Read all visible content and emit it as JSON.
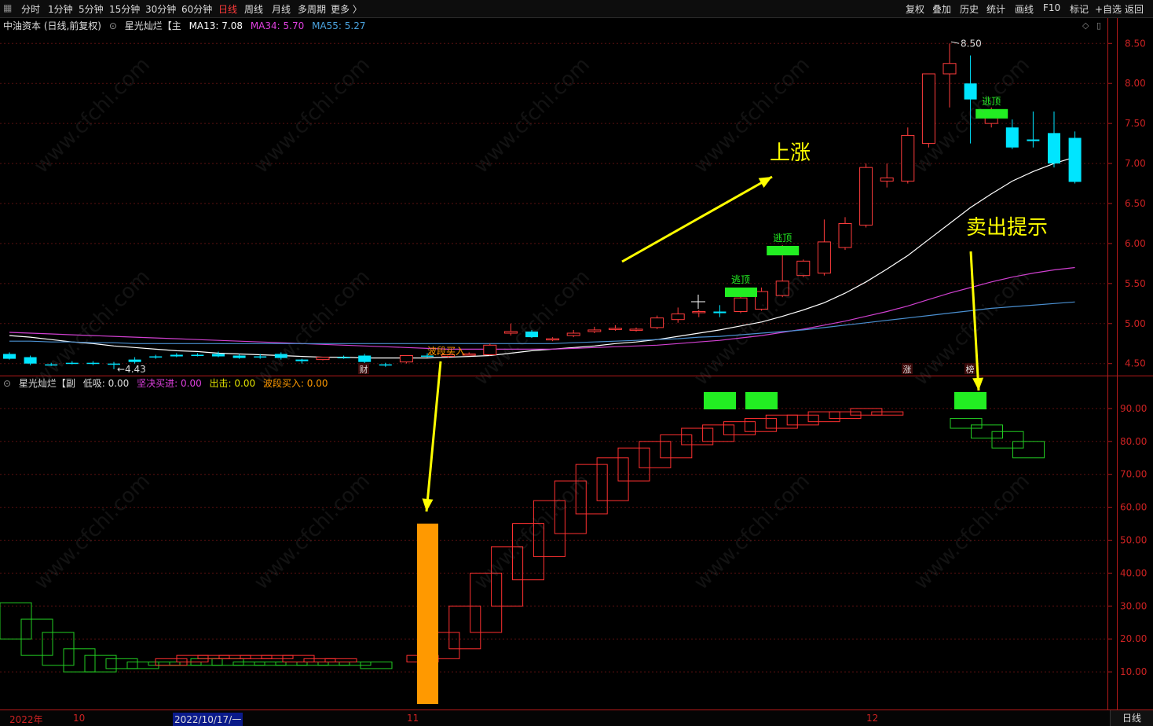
{
  "toolbar": {
    "left_items": [
      "分时",
      "1分钟",
      "5分钟",
      "15分钟",
      "30分钟",
      "60分钟",
      "日线",
      "周线",
      "月线",
      "多周期",
      "更多 〉"
    ],
    "active_index": 6,
    "right_items": [
      "复权",
      "叠加",
      "历史",
      "统计",
      "画线",
      "F10",
      "标记",
      "+自选",
      "返回"
    ]
  },
  "main_info": {
    "stock": "中油资本 (日线,前复权)",
    "indicator": "星光灿烂【主",
    "ma13": "MA13: 7.08",
    "ma34": "MA34: 5.70",
    "ma55": "MA55: 5.27",
    "colors": {
      "ma13": "#ffffff",
      "ma34": "#e040e0",
      "ma55": "#4aa3df"
    }
  },
  "sub_info": {
    "indicator": "星光灿烂【副",
    "dixi": "低吸: 0.00",
    "jianjue": "坚决买进: 0.00",
    "chuji": "出击: 0.00",
    "boduan": "波段买入: 0.00",
    "colors": {
      "dixi": "#dddddd",
      "jianjue": "#e040e0",
      "chuji": "#e0e000",
      "boduan": "#ff9900"
    }
  },
  "annotations": {
    "rise": "上涨",
    "sell_hint": "卖出提示",
    "escape": "逃顶",
    "wave_buy": "波段买入",
    "cai": "财",
    "zhang": "涨",
    "bang": "榜",
    "high_label": "8.50",
    "low_label": "4.43"
  },
  "bottom_bar": {
    "labels": [
      "2022年",
      "10",
      "2022/10/17/一",
      "11",
      "12"
    ],
    "right_button": "日线"
  },
  "watermark": "www.cfchi.com",
  "chart_data": [
    {
      "type": "candlestick",
      "title": "中油资本 (日线,前复权)",
      "ylim": [
        4.35,
        8.65
      ],
      "y_ticks": [
        4.5,
        5.0,
        5.5,
        6.0,
        6.5,
        7.0,
        7.5,
        8.0,
        8.5
      ],
      "candles": [
        [
          4.62,
          4.64,
          4.56,
          4.55
        ],
        [
          4.58,
          4.6,
          4.5,
          4.48
        ],
        [
          4.49,
          4.51,
          4.48,
          4.47
        ],
        [
          4.51,
          4.53,
          4.5,
          4.49
        ],
        [
          4.51,
          4.53,
          4.5,
          4.48
        ],
        [
          4.5,
          4.52,
          4.49,
          4.43
        ],
        [
          4.55,
          4.58,
          4.52,
          4.5
        ],
        [
          4.59,
          4.61,
          4.58,
          4.56
        ],
        [
          4.61,
          4.63,
          4.59,
          4.58
        ],
        [
          4.61,
          4.63,
          4.6,
          4.59
        ],
        [
          4.62,
          4.65,
          4.59,
          4.58
        ],
        [
          4.6,
          4.62,
          4.57,
          4.56
        ],
        [
          4.59,
          4.62,
          4.58,
          4.56
        ],
        [
          4.62,
          4.64,
          4.57,
          4.55
        ],
        [
          4.55,
          4.56,
          4.53,
          4.5
        ],
        [
          4.55,
          4.57,
          4.58,
          4.54
        ],
        [
          4.58,
          4.6,
          4.57,
          4.56
        ],
        [
          4.6,
          4.62,
          4.52,
          4.5
        ],
        [
          4.49,
          4.51,
          4.48,
          4.46
        ],
        [
          4.52,
          4.6,
          4.6,
          4.5
        ],
        [
          4.6,
          4.63,
          4.59,
          4.58
        ],
        [
          4.59,
          4.62,
          4.61,
          4.57
        ],
        [
          4.61,
          4.64,
          4.62,
          4.6
        ],
        [
          4.61,
          4.75,
          4.73,
          4.6
        ],
        [
          4.88,
          5.0,
          4.9,
          4.85
        ],
        [
          4.9,
          4.92,
          4.83,
          4.82
        ],
        [
          4.81,
          4.83,
          4.81,
          4.78
        ],
        [
          4.85,
          4.92,
          4.88,
          4.83
        ],
        [
          4.9,
          4.96,
          4.92,
          4.88
        ],
        [
          4.93,
          4.98,
          4.94,
          4.91
        ],
        [
          4.92,
          4.95,
          4.93,
          4.9
        ],
        [
          4.95,
          5.1,
          5.07,
          4.93
        ],
        [
          5.05,
          5.2,
          5.12,
          5.01
        ],
        [
          5.14,
          5.17,
          5.15,
          5.08
        ],
        [
          5.15,
          5.23,
          5.13,
          5.08
        ],
        [
          5.15,
          5.35,
          5.32,
          5.13
        ],
        [
          5.18,
          5.45,
          5.4,
          5.16
        ],
        [
          5.35,
          5.98,
          5.53,
          5.33
        ],
        [
          5.6,
          5.8,
          5.78,
          5.58
        ],
        [
          5.63,
          6.3,
          6.02,
          5.6
        ],
        [
          5.95,
          6.33,
          6.25,
          5.92
        ],
        [
          6.23,
          7.0,
          6.95,
          6.2
        ],
        [
          6.78,
          7.0,
          6.82,
          6.7
        ],
        [
          6.78,
          7.45,
          7.35,
          6.75
        ],
        [
          7.25,
          7.55,
          8.12,
          7.2
        ],
        [
          8.12,
          8.5,
          8.25,
          7.7
        ],
        [
          8.0,
          8.35,
          7.8,
          7.25
        ],
        [
          7.5,
          7.7,
          7.65,
          7.45
        ],
        [
          7.45,
          7.55,
          7.2,
          7.18
        ],
        [
          7.3,
          7.65,
          7.28,
          7.2
        ],
        [
          7.38,
          7.65,
          7.0,
          6.95
        ],
        [
          7.32,
          7.4,
          6.77,
          6.75
        ]
      ],
      "series": [
        {
          "name": "MA13",
          "values": [
            4.85,
            4.83,
            4.8,
            4.77,
            4.75,
            4.72,
            4.7,
            4.68,
            4.66,
            4.65,
            4.63,
            4.62,
            4.61,
            4.6,
            4.59,
            4.58,
            4.58,
            4.57,
            4.57,
            4.57,
            4.57,
            4.58,
            4.59,
            4.6,
            4.63,
            4.66,
            4.68,
            4.7,
            4.72,
            4.75,
            4.77,
            4.8,
            4.84,
            4.88,
            4.92,
            4.97,
            5.02,
            5.09,
            5.17,
            5.26,
            5.38,
            5.52,
            5.68,
            5.85,
            6.05,
            6.25,
            6.45,
            6.62,
            6.78,
            6.9,
            7.0,
            7.08
          ]
        },
        {
          "name": "MA34",
          "values": [
            4.89,
            4.88,
            4.87,
            4.86,
            4.85,
            4.84,
            4.83,
            4.82,
            4.81,
            4.8,
            4.79,
            4.78,
            4.77,
            4.76,
            4.75,
            4.74,
            4.73,
            4.72,
            4.71,
            4.7,
            4.69,
            4.68,
            4.68,
            4.68,
            4.68,
            4.68,
            4.68,
            4.69,
            4.7,
            4.71,
            4.72,
            4.73,
            4.75,
            4.77,
            4.79,
            4.82,
            4.85,
            4.89,
            4.93,
            4.98,
            5.03,
            5.09,
            5.15,
            5.22,
            5.3,
            5.38,
            5.45,
            5.52,
            5.58,
            5.63,
            5.67,
            5.7
          ]
        },
        {
          "name": "MA55",
          "values": [
            4.78,
            4.78,
            4.77,
            4.77,
            4.76,
            4.76,
            4.75,
            4.75,
            4.75,
            4.75,
            4.75,
            4.75,
            4.75,
            4.75,
            4.75,
            4.75,
            4.75,
            4.75,
            4.75,
            4.75,
            4.75,
            4.75,
            4.75,
            4.75,
            4.75,
            4.75,
            4.75,
            4.76,
            4.77,
            4.78,
            4.79,
            4.8,
            4.81,
            4.83,
            4.84,
            4.86,
            4.88,
            4.9,
            4.92,
            4.95,
            4.98,
            5.01,
            5.04,
            5.07,
            5.1,
            5.13,
            5.16,
            5.19,
            5.21,
            5.23,
            5.25,
            5.27
          ]
        }
      ],
      "escape_signals": [
        {
          "index": 35,
          "value": 5.45
        },
        {
          "index": 37,
          "value": 5.97
        },
        {
          "index": 47,
          "value": 7.68
        }
      ]
    },
    {
      "type": "bar",
      "title": "星光灿烂【副",
      "ylim": [
        0,
        100
      ],
      "y_ticks": [
        10,
        20,
        30,
        40,
        50,
        60,
        70,
        80,
        90
      ],
      "boxes_green_early": [
        [
          31,
          20
        ],
        [
          26,
          15
        ],
        [
          22,
          12
        ],
        [
          17,
          10
        ],
        [
          15,
          10
        ],
        [
          14,
          11
        ],
        [
          13,
          11
        ],
        [
          13,
          12
        ],
        [
          13,
          12
        ],
        [
          14,
          12
        ],
        [
          14,
          12
        ],
        [
          13,
          12
        ],
        [
          13,
          12
        ],
        [
          13,
          12
        ],
        [
          13,
          12
        ],
        [
          13,
          12
        ],
        [
          13,
          12
        ],
        [
          13,
          11
        ]
      ],
      "boxes_red_flat": [
        [
          14,
          12
        ],
        [
          15,
          13
        ],
        [
          15,
          14
        ],
        [
          15,
          14
        ],
        [
          15,
          14
        ],
        [
          15,
          14
        ],
        [
          15,
          13
        ],
        [
          14,
          13
        ],
        [
          14,
          13
        ]
      ],
      "boxes_red_rise": [
        [
          15,
          13
        ],
        [
          22,
          14
        ],
        [
          30,
          17
        ],
        [
          40,
          22
        ],
        [
          48,
          30
        ],
        [
          55,
          38
        ],
        [
          62,
          45
        ],
        [
          68,
          52
        ],
        [
          73,
          58
        ],
        [
          75,
          62
        ],
        [
          78,
          68
        ],
        [
          80,
          72
        ],
        [
          82,
          75
        ],
        [
          84,
          79
        ],
        [
          85,
          80
        ],
        [
          86,
          82
        ],
        [
          87,
          83
        ],
        [
          88,
          84
        ],
        [
          88,
          85
        ],
        [
          89,
          86
        ],
        [
          89,
          87
        ],
        [
          90,
          88
        ],
        [
          89,
          88
        ]
      ],
      "boxes_green_late": [
        [
          87,
          84
        ],
        [
          85,
          81
        ],
        [
          83,
          78
        ],
        [
          80,
          75
        ]
      ],
      "wave_buy_bar": [
        0,
        55
      ],
      "signal_blocks": [
        {
          "name": "逃顶",
          "value": 90
        },
        {
          "name": "逃顶",
          "value": 90
        },
        {
          "name": "逃顶",
          "value": 90
        }
      ]
    }
  ]
}
